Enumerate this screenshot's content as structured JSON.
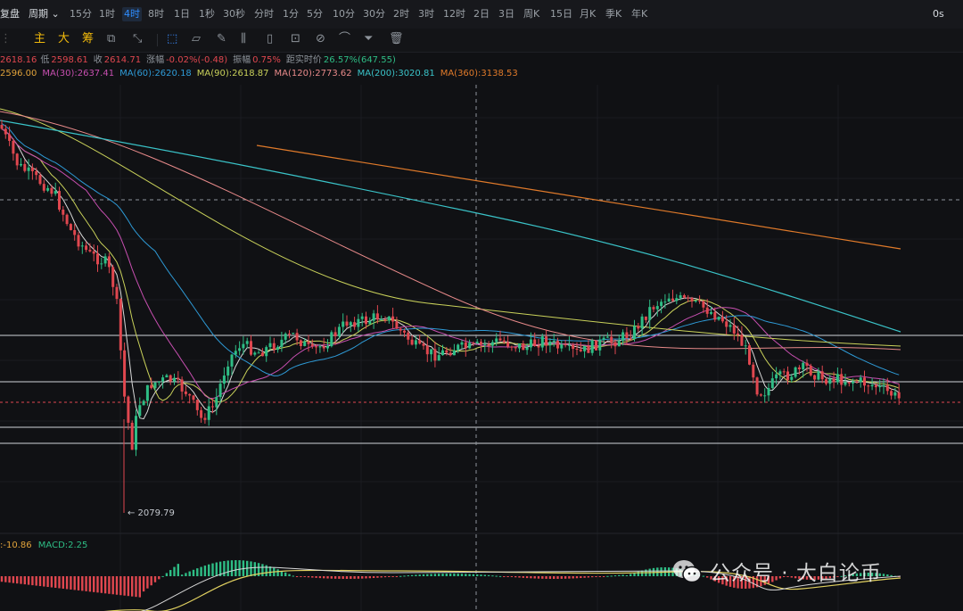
{
  "topbar": {
    "items": [
      "复盘",
      "周期",
      "15分",
      "1时",
      "4时",
      "8时",
      "1日",
      "1秒",
      "30秒",
      "分时",
      "1分",
      "5分",
      "10分",
      "30分",
      "2时",
      "3时",
      "12时",
      "2日",
      "3日",
      "周K",
      "15日",
      "月K",
      "季K",
      "年K"
    ],
    "active": "4时",
    "right_text": "0s"
  },
  "toolbar": {
    "indicators": [
      "主",
      "大",
      "筹"
    ],
    "icons": [
      "indicator-settings-icon",
      "draw-line-icon",
      "cursor-select-icon",
      "ruler-icon",
      "brush-icon",
      "bar-pattern-icon",
      "text-note-icon",
      "lock-icon",
      "magnet-icon",
      "fib-arc-icon",
      "filter-icon",
      "trash-icon"
    ]
  },
  "ohlc": {
    "open": "2618.16",
    "low_label": "低",
    "low": "2598.61",
    "close_label": "收",
    "close": "2614.71",
    "change_label": "涨幅",
    "change": "-0.02%(-0.48)",
    "amp_label": "振幅",
    "amp": "0.75%",
    "countdown_label": "距实时价",
    "countdown": "26.57%(647.55)"
  },
  "ma": {
    "ma_short": "2596.00",
    "ma30": "MA(30):2637.41",
    "ma60": "MA(60):2620.18",
    "ma90": "MA(90):2618.87",
    "ma120": "MA(120):2773.62",
    "ma200": "MA(200):3020.81",
    "ma360": "MA(360):3138.53"
  },
  "colors": {
    "up": "#2ebd85",
    "down": "#e0474f",
    "ma_short": "#e0a23a",
    "ma30": "#c74fb0",
    "ma60": "#2e9ad6",
    "ma90": "#c9d15a",
    "ma120": "#e88a8a",
    "ma200": "#3ac3c8",
    "ma360": "#e07a2a"
  },
  "low_marker": "← 2079.79",
  "macd": {
    "dea": ":-10.86",
    "macd": "MACD:2.25"
  },
  "watermark": {
    "text": "公众号 · 大白论币"
  }
}
